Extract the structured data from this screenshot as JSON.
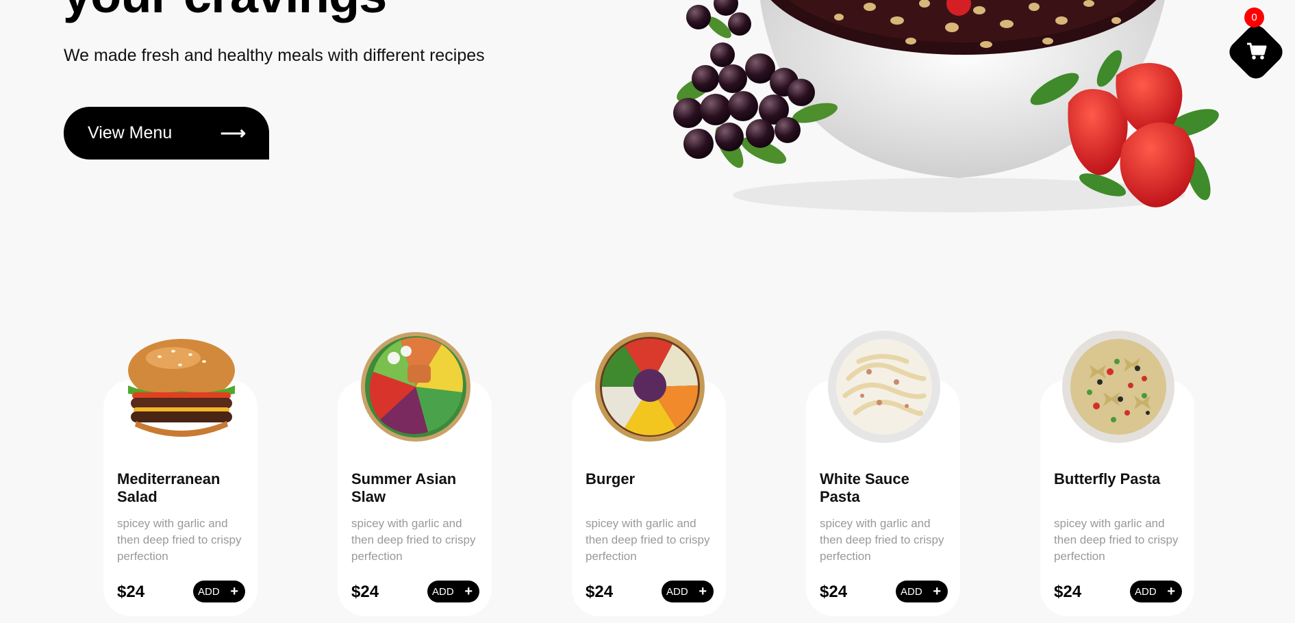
{
  "hero": {
    "title": "your cravings",
    "subtitle": "We made fresh and healthy meals with different recipes",
    "cta_label": "View Menu"
  },
  "cart": {
    "count": "0"
  },
  "menu": [
    {
      "name": "Mediterranean Salad",
      "description": "spicey with garlic and then deep fried to crispy perfection",
      "price": "$24",
      "add_label": "ADD"
    },
    {
      "name": "Summer Asian Slaw",
      "description": "spicey with garlic and then deep fried to crispy perfection",
      "price": "$24",
      "add_label": "ADD"
    },
    {
      "name": "Burger",
      "description": "spicey with garlic and then deep fried to crispy perfection",
      "price": "$24",
      "add_label": "ADD"
    },
    {
      "name": "White Sauce Pasta",
      "description": "spicey with garlic and then deep fried to crispy perfection",
      "price": "$24",
      "add_label": "ADD"
    },
    {
      "name": "Butterfly Pasta",
      "description": "spicey with garlic and then deep fried to crispy perfection",
      "price": "$24",
      "add_label": "ADD"
    }
  ]
}
